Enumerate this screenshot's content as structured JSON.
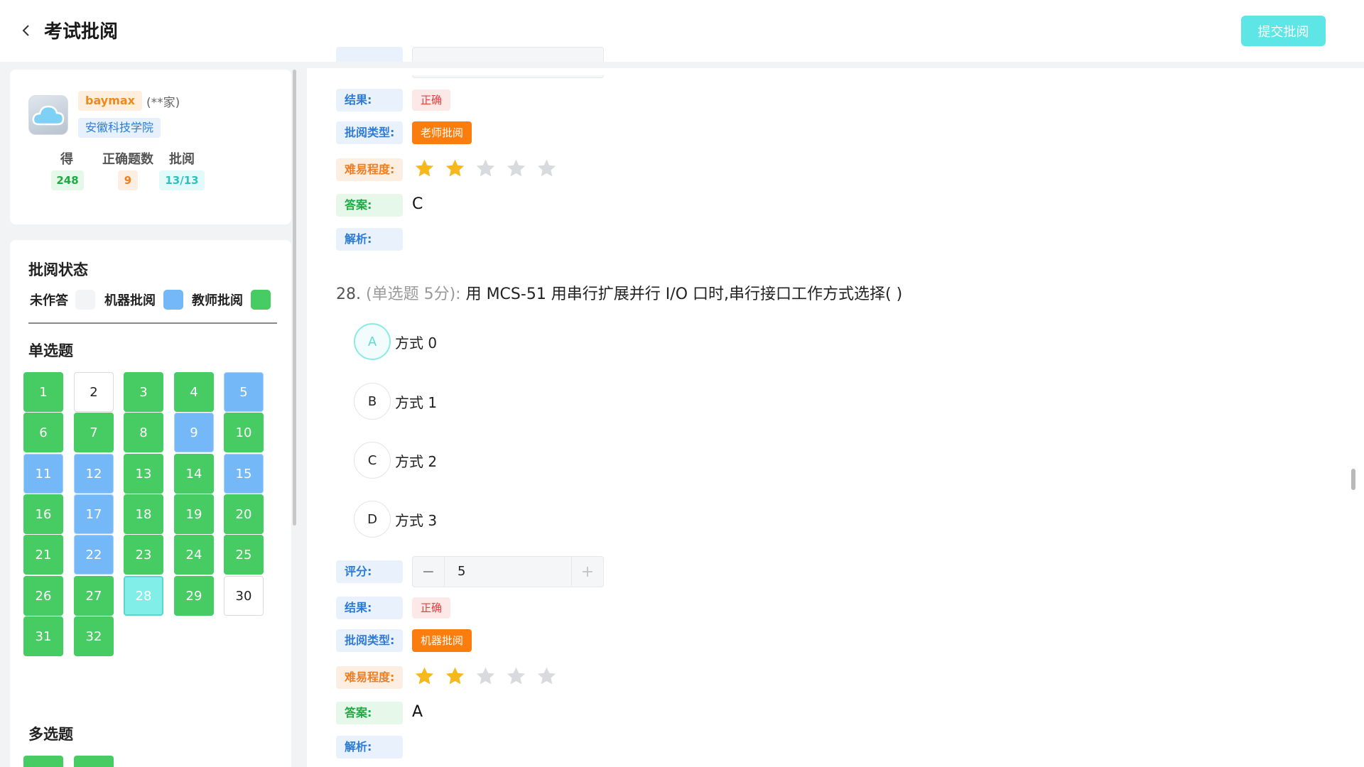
{
  "header": {
    "title": "考试批阅",
    "submit_label": "提交批阅"
  },
  "user": {
    "name": "baymax",
    "name_suffix": "(**家)",
    "school": "安徽科技学院",
    "stats": [
      {
        "label": "得分",
        "value": "248"
      },
      {
        "label": "正确题数",
        "value": "9"
      },
      {
        "label": "批阅",
        "value": "13/13"
      }
    ]
  },
  "review_status": {
    "title": "批阅状态",
    "legend": [
      {
        "label": "未作答",
        "color": "#f3f4f6"
      },
      {
        "label": "机器批阅",
        "color": "#74b8f7"
      },
      {
        "label": "教师批阅",
        "color": "#47cb63"
      }
    ]
  },
  "sections": {
    "single_choice": "单选题",
    "multi_choice": "多选题"
  },
  "single_questions": [
    {
      "n": "1",
      "status": "teacher"
    },
    {
      "n": "2",
      "status": "none"
    },
    {
      "n": "3",
      "status": "teacher"
    },
    {
      "n": "4",
      "status": "teacher"
    },
    {
      "n": "5",
      "status": "machine"
    },
    {
      "n": "6",
      "status": "teacher"
    },
    {
      "n": "7",
      "status": "teacher"
    },
    {
      "n": "8",
      "status": "teacher"
    },
    {
      "n": "9",
      "status": "machine"
    },
    {
      "n": "10",
      "status": "teacher"
    },
    {
      "n": "11",
      "status": "machine"
    },
    {
      "n": "12",
      "status": "machine"
    },
    {
      "n": "13",
      "status": "teacher"
    },
    {
      "n": "14",
      "status": "teacher"
    },
    {
      "n": "15",
      "status": "machine"
    },
    {
      "n": "16",
      "status": "teacher"
    },
    {
      "n": "17",
      "status": "machine"
    },
    {
      "n": "18",
      "status": "teacher"
    },
    {
      "n": "19",
      "status": "teacher"
    },
    {
      "n": "20",
      "status": "teacher"
    },
    {
      "n": "21",
      "status": "teacher"
    },
    {
      "n": "22",
      "status": "machine"
    },
    {
      "n": "23",
      "status": "teacher"
    },
    {
      "n": "24",
      "status": "teacher"
    },
    {
      "n": "25",
      "status": "teacher"
    },
    {
      "n": "26",
      "status": "teacher"
    },
    {
      "n": "27",
      "status": "teacher"
    },
    {
      "n": "28",
      "status": "current"
    },
    {
      "n": "29",
      "status": "teacher"
    },
    {
      "n": "30",
      "status": "none"
    },
    {
      "n": "31",
      "status": "teacher"
    },
    {
      "n": "32",
      "status": "teacher"
    }
  ],
  "multi_questions": [
    {
      "n": "",
      "status": "teacher"
    },
    {
      "n": "",
      "status": "teacher"
    }
  ],
  "labels": {
    "score": "评分:",
    "result": "结果:",
    "review_type": "批阅类型:",
    "difficulty": "难易程度:",
    "answer": "答案:",
    "analysis": "解析:"
  },
  "prev_question": {
    "result": "正确",
    "review_type": "老师批阅",
    "difficulty": 2,
    "answer": "C"
  },
  "current_question": {
    "number": "28.",
    "meta": "(单选题 5分):",
    "text": "用 MCS-51 用串行扩展并行 I/O 口时,串行接口工作方式选择( )",
    "options": [
      {
        "letter": "A",
        "text": "方式 0",
        "selected": true
      },
      {
        "letter": "B",
        "text": "方式 1",
        "selected": false
      },
      {
        "letter": "C",
        "text": "方式 2",
        "selected": false
      },
      {
        "letter": "D",
        "text": "方式 3",
        "selected": false
      }
    ],
    "score": "5",
    "result": "正确",
    "review_type": "机器批阅",
    "difficulty": 2,
    "answer": "A"
  },
  "colors": {
    "accent": "#5ee6e6",
    "teacher": "#47cb63",
    "machine": "#74b8f7",
    "star_on": "#f5b81d",
    "star_off": "#d9dadd",
    "type_tag": "#fb7d0e"
  }
}
